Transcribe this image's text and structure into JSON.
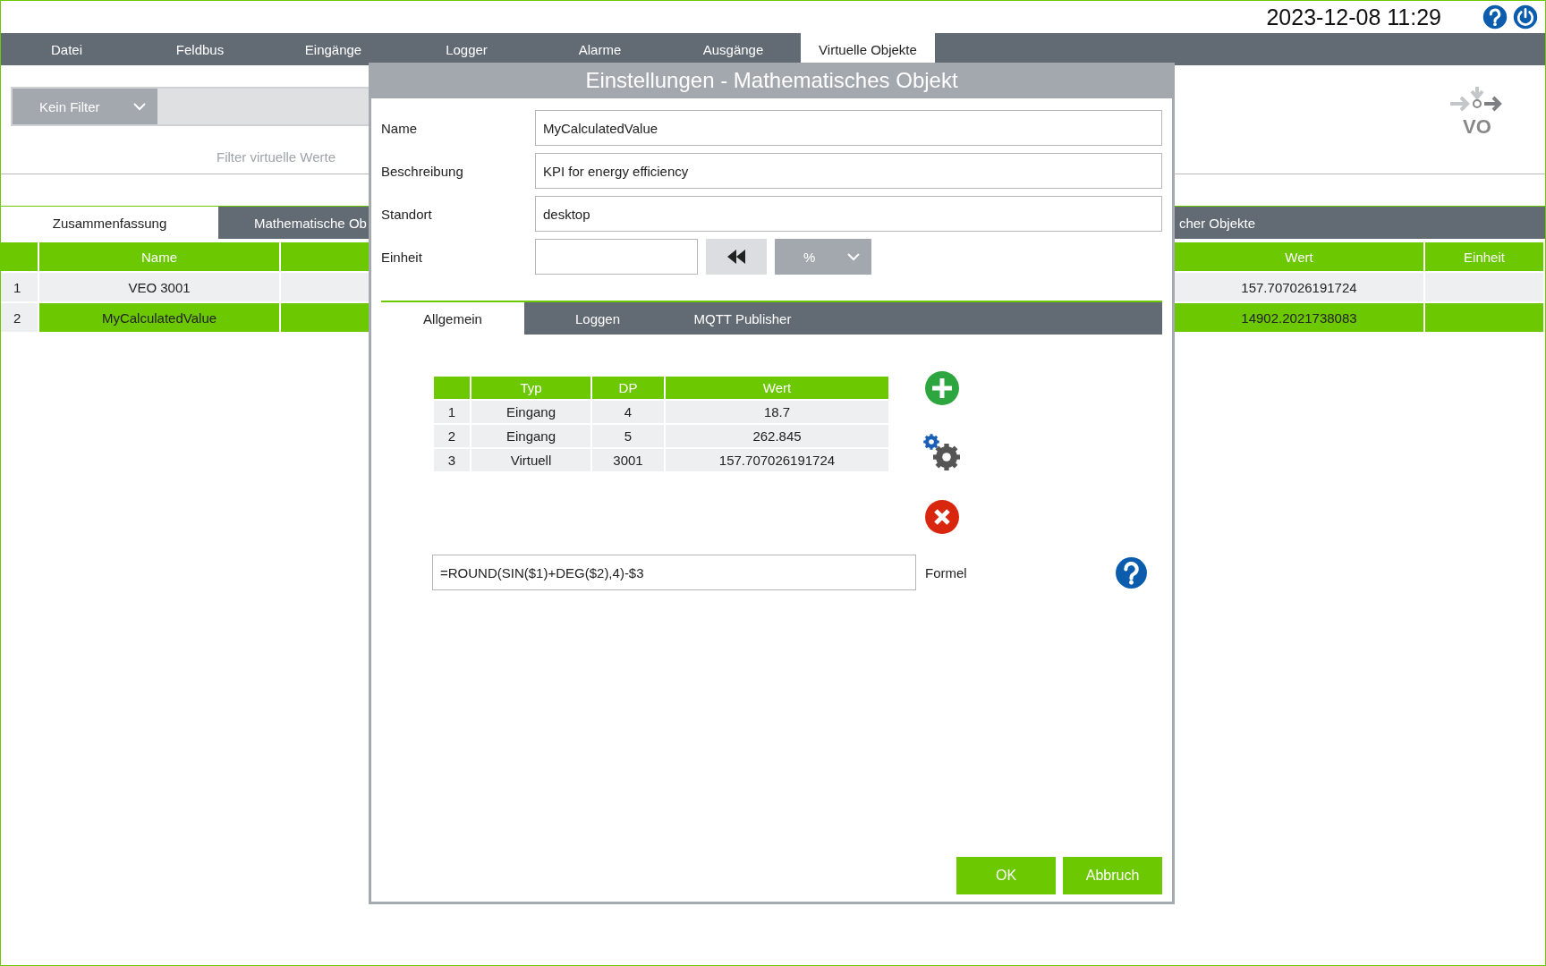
{
  "header": {
    "datetime": "2023-12-08 11:29"
  },
  "menu_tabs": [
    {
      "label": "Datei",
      "selected": false
    },
    {
      "label": "Feldbus",
      "selected": false
    },
    {
      "label": "Eingänge",
      "selected": false
    },
    {
      "label": "Logger",
      "selected": false
    },
    {
      "label": "Alarme",
      "selected": false
    },
    {
      "label": "Ausgänge",
      "selected": false
    },
    {
      "label": "Virtuelle Objekte",
      "selected": true
    }
  ],
  "filter": {
    "dropdown": "Kein Filter",
    "caption": "Filter virtuelle Werte"
  },
  "logo": {
    "text": "VO"
  },
  "view_tabs": [
    {
      "label": "Zusammenfassung",
      "selected": true
    },
    {
      "label": "Mathematische Ob",
      "selected": false
    },
    {
      "label": "cher Objekte",
      "selected": false
    }
  ],
  "table": {
    "columns": [
      "Name",
      "Wert",
      "Einheit"
    ],
    "rows": [
      {
        "index": "1",
        "name": "VEO 3001",
        "value": "157.707026191724",
        "selected": false
      },
      {
        "index": "2",
        "name": "MyCalculatedValue",
        "value": "14902.2021738083",
        "selected": true
      }
    ]
  },
  "dialog": {
    "title": "Einstellungen - Mathematisches Objekt",
    "fields": [
      {
        "label": "Name",
        "value": "MyCalculatedValue"
      },
      {
        "label": "Beschreibung",
        "value": "KPI for energy efficiency"
      },
      {
        "label": "Standort",
        "value": "desktop"
      }
    ],
    "unit": {
      "label": "Einheit",
      "dropdown": "%"
    },
    "tabs": [
      {
        "label": "Allgemein",
        "selected": true
      },
      {
        "label": "Loggen",
        "selected": false
      },
      {
        "label": "MQTT Publisher",
        "selected": false
      }
    ],
    "table": {
      "columns": [
        "Typ",
        "DP",
        "Wert"
      ],
      "rows": [
        {
          "index": "1",
          "type": "Eingang",
          "dp": "4",
          "value": "18.7"
        },
        {
          "index": "2",
          "type": "Eingang",
          "dp": "5",
          "value": "262.845"
        },
        {
          "index": "3",
          "type": "Virtuell",
          "dp": "3001",
          "value": "157.707026191724"
        }
      ]
    },
    "formula": {
      "value": "=ROUND(SIN($1)+DEG($2),4)-$3",
      "label": "Formel"
    },
    "buttons": [
      "OK",
      "Abbruch"
    ]
  }
}
